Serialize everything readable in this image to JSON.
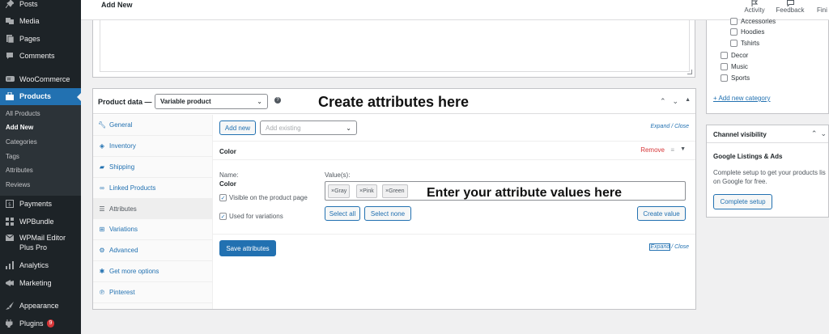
{
  "sidebar": {
    "items": [
      {
        "icon": "pin-icon",
        "label": "Posts"
      },
      {
        "icon": "media-icon",
        "label": "Media"
      },
      {
        "icon": "pages-icon",
        "label": "Pages"
      },
      {
        "icon": "comments-icon",
        "label": "Comments"
      },
      {
        "icon": "woo-icon",
        "label": "WooCommerce"
      },
      {
        "icon": "products-icon",
        "label": "Products"
      }
    ],
    "submenu": [
      "All Products",
      "Add New",
      "Categories",
      "Tags",
      "Attributes",
      "Reviews"
    ],
    "items_after": [
      {
        "icon": "payments-icon",
        "label": "Payments"
      },
      {
        "icon": "grid-icon",
        "label": "WPBundle"
      },
      {
        "icon": "mail-icon",
        "label": "WPMail Editor Plus Pro"
      },
      {
        "icon": "analytics-icon",
        "label": "Analytics"
      },
      {
        "icon": "megaphone-icon",
        "label": "Marketing"
      },
      {
        "icon": "brush-icon",
        "label": "Appearance"
      },
      {
        "icon": "plugin-icon",
        "label": "Plugins",
        "badge": "9"
      }
    ]
  },
  "topbar": {
    "title": "Add New",
    "activity": "Activity",
    "feedback": "Feedback",
    "finish": "Fini"
  },
  "product_data": {
    "label": "Product data —",
    "type_select": "Variable product",
    "help": "?",
    "annotation_top": "Create attributes here",
    "annotation_values": "Enter your attribute values here",
    "tabs": [
      {
        "icon": "wrench-icon",
        "label": "General"
      },
      {
        "icon": "tag-icon",
        "label": "Inventory"
      },
      {
        "icon": "truck-icon",
        "label": "Shipping"
      },
      {
        "icon": "link-icon",
        "label": "Linked Products"
      },
      {
        "icon": "list-icon",
        "label": "Attributes"
      },
      {
        "icon": "grid-icon",
        "label": "Variations"
      },
      {
        "icon": "gear-icon",
        "label": "Advanced"
      },
      {
        "icon": "plug-icon",
        "label": "Get more options"
      },
      {
        "icon": "pinterest-icon",
        "label": "Pinterest"
      }
    ],
    "add_new": "Add new",
    "add_existing_placeholder": "Add existing",
    "expand": "Expand",
    "close": "Close",
    "expand_close_sep": "/",
    "attribute": {
      "name": "Color",
      "remove": "Remove",
      "name_label": "Name:",
      "name_value": "Color",
      "visible_label": "Visible on the product page",
      "variations_label": "Used for variations",
      "values_label": "Value(s):",
      "values": [
        "Gray",
        "Pink",
        "Green"
      ],
      "select_all": "Select all",
      "select_none": "Select none",
      "create_value": "Create value"
    },
    "save": "Save attributes"
  },
  "categories": {
    "items": [
      {
        "label": "Accessories",
        "indent": true
      },
      {
        "label": "Hoodies",
        "indent": true
      },
      {
        "label": "Tshirts",
        "indent": true
      },
      {
        "label": "Decor",
        "indent": false
      },
      {
        "label": "Music",
        "indent": false
      },
      {
        "label": "Sports",
        "indent": false
      }
    ],
    "add_new": "+ Add new category"
  },
  "channel": {
    "title": "Channel visibility",
    "subtitle": "Google Listings & Ads",
    "text_line1": "Complete setup to get your products lis",
    "text_line2": "on Google for free.",
    "button": "Complete setup"
  },
  "colors": {
    "sidebar_bg": "#1d2327",
    "accent": "#2271b1",
    "remove": "#d63638"
  }
}
